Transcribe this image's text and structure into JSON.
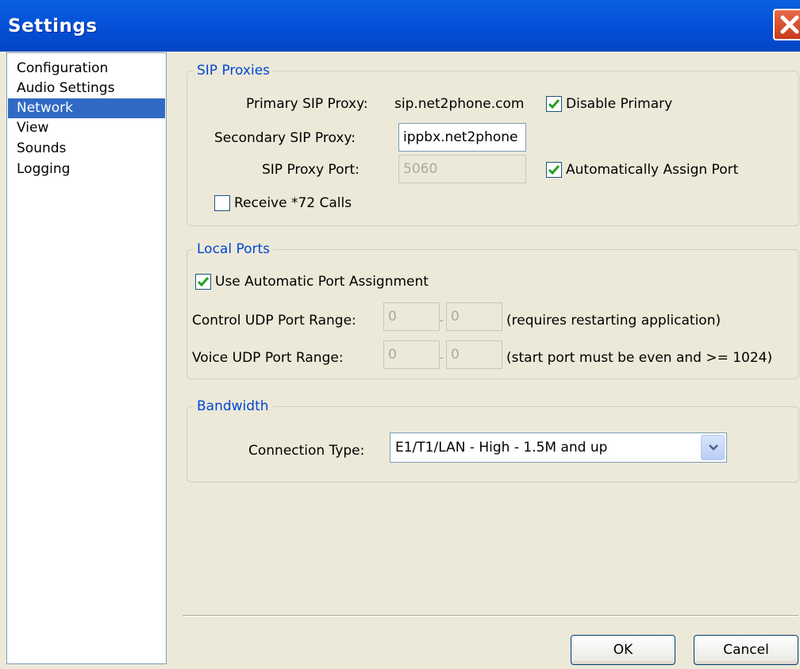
{
  "window": {
    "title": "Settings"
  },
  "nav": {
    "items": [
      {
        "label": "Configuration"
      },
      {
        "label": "Audio Settings"
      },
      {
        "label": "Network"
      },
      {
        "label": "View"
      },
      {
        "label": "Sounds"
      },
      {
        "label": "Logging"
      }
    ],
    "selected": "Network"
  },
  "sip_proxies": {
    "title": "SIP Proxies",
    "primary_label": "Primary SIP Proxy:",
    "primary_value": "sip.net2phone.com",
    "disable_primary_label": "Disable Primary",
    "disable_primary_checked": true,
    "secondary_label": "Secondary SIP Proxy:",
    "secondary_value": "ippbx.net2phone",
    "port_label": "SIP Proxy Port:",
    "port_value": "5060",
    "auto_assign_label": "Automatically Assign Port",
    "auto_assign_checked": true,
    "receive72_label": "Receive *72 Calls",
    "receive72_checked": false
  },
  "local_ports": {
    "title": "Local Ports",
    "auto_label": "Use Automatic Port Assignment",
    "auto_checked": true,
    "control_label": "Control UDP Port Range:",
    "control_from": "0",
    "control_to": "0",
    "control_note": "(requires restarting application)",
    "voice_label": "Voice UDP Port Range:",
    "voice_from": "0",
    "voice_to": "0",
    "voice_note": "(start port must be even and >= 1024)"
  },
  "bandwidth": {
    "title": "Bandwidth",
    "connection_label": "Connection Type:",
    "connection_value": "E1/T1/LAN - High - 1.5M and up"
  },
  "buttons": {
    "ok": "OK",
    "cancel": "Cancel"
  },
  "colors": {
    "titlebar": "#0550d8",
    "selection": "#316ac5",
    "group_title": "#0046d5",
    "check": "#21a121"
  },
  "icons": {
    "close": "close-icon",
    "check": "checkmark-icon",
    "dropdown": "chevron-down-icon"
  }
}
